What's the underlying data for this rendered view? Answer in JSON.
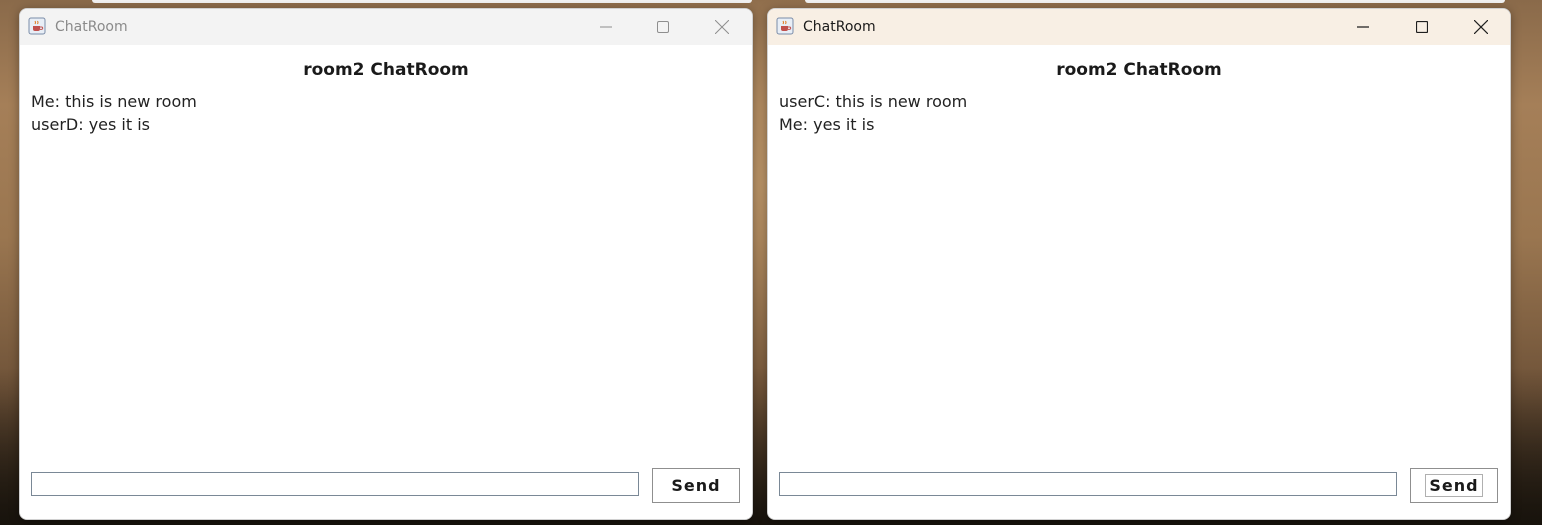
{
  "windows": [
    {
      "window_title": "ChatRoom",
      "room_title": "room2 ChatRoom",
      "messages": [
        "Me: this is new room",
        "userD: yes it is"
      ],
      "input_value": "",
      "send_label": "Send",
      "active": false
    },
    {
      "window_title": "ChatRoom",
      "room_title": "room2 ChatRoom",
      "messages": [
        "userC: this is new room",
        "Me: yes it is"
      ],
      "input_value": "",
      "send_label": "Send",
      "active": true
    }
  ],
  "icons": {
    "app": "java-coffee-cup-icon",
    "minimize": "minimize-icon",
    "maximize": "maximize-icon",
    "close": "close-icon"
  },
  "colors": {
    "inactive_title_text": "#8a8a8a",
    "active_title_text": "#1a1a1a",
    "active_titlebar": "#f8efe4",
    "inactive_titlebar": "#f3f3f3"
  }
}
